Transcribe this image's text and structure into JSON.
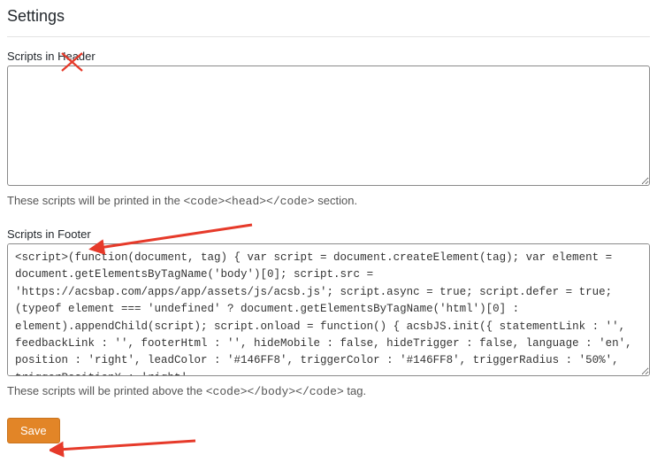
{
  "page": {
    "title": "Settings"
  },
  "header_section": {
    "label": "Scripts in Header",
    "value": "",
    "help_prefix": "These scripts will be printed in the ",
    "help_code": "<code><head></code>",
    "help_suffix": " section."
  },
  "footer_section": {
    "label": "Scripts in Footer",
    "value": "<script>(function(document, tag) { var script = document.createElement(tag); var element = document.getElementsByTagName('body')[0]; script.src = 'https://acsbap.com/apps/app/assets/js/acsb.js'; script.async = true; script.defer = true; (typeof element === 'undefined' ? document.getElementsByTagName('html')[0] : element).appendChild(script); script.onload = function() { acsbJS.init({ statementLink : '', feedbackLink : '', footerHtml : '', hideMobile : false, hideTrigger : false, language : 'en', position : 'right', leadColor : '#146FF8', triggerColor : '#146FF8', triggerRadius : '50%', triggerPositionX : 'right',",
    "help_prefix": "These scripts will be printed above the ",
    "help_code": "<code></body></code>",
    "help_suffix": " tag."
  },
  "actions": {
    "save_label": "Save"
  },
  "annotations": {
    "x_mark": "red-x",
    "arrow_1": "red-arrow",
    "arrow_2": "red-arrow"
  }
}
